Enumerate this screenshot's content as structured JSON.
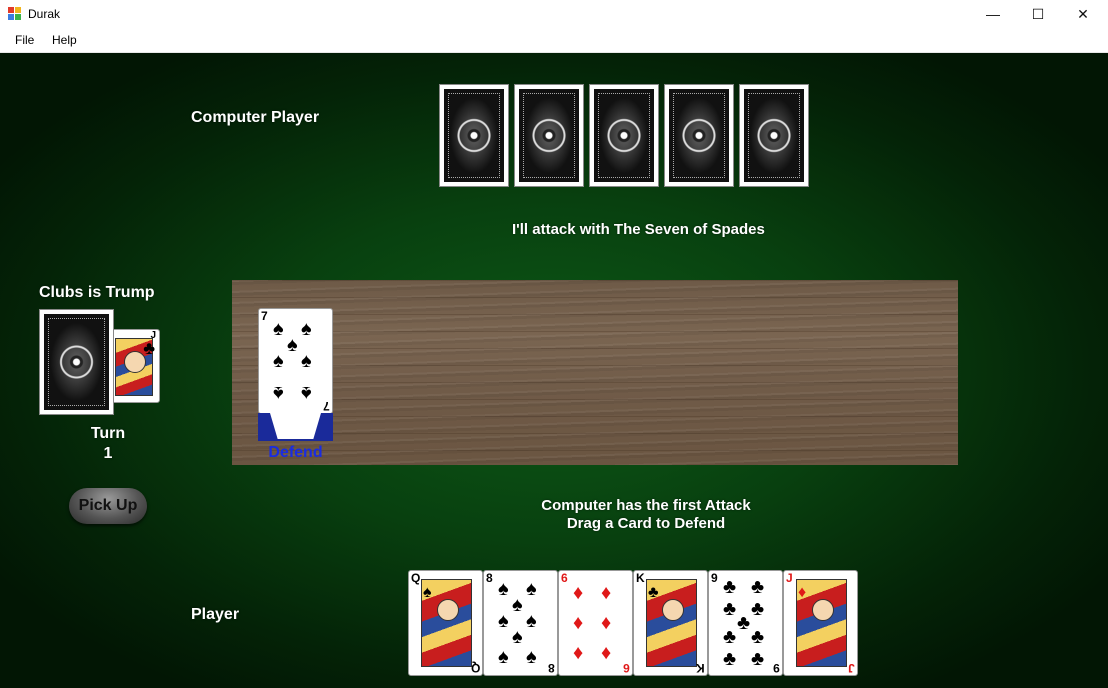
{
  "window": {
    "title": "Durak",
    "minimize": "—",
    "maximize": "☐",
    "close": "✕"
  },
  "menu": {
    "file": "File",
    "help": "Help"
  },
  "labels": {
    "computer_player": "Computer Player",
    "computer_message": "I'll attack with The Seven of Spades",
    "trump": "Clubs is Trump",
    "turn_label": "Turn",
    "turn_number": "1",
    "defend": "Defend",
    "status_line1": "Computer has the first Attack",
    "status_line2": "Drag a Card to Defend",
    "player": "Player",
    "pick_up": "Pick Up"
  },
  "computer_hand_count": 5,
  "trump_card": {
    "rank": "J",
    "suit": "♣",
    "color": "black"
  },
  "attack_card": {
    "rank": "7",
    "suit": "♠",
    "color": "black"
  },
  "player_hand": [
    {
      "rank": "Q",
      "suit": "♠",
      "color": "black",
      "court": true
    },
    {
      "rank": "8",
      "suit": "♠",
      "color": "black",
      "court": false
    },
    {
      "rank": "6",
      "suit": "♦",
      "color": "red",
      "court": false
    },
    {
      "rank": "K",
      "suit": "♣",
      "color": "black",
      "court": true
    },
    {
      "rank": "9",
      "suit": "♣",
      "color": "black",
      "court": false
    },
    {
      "rank": "J",
      "suit": "♦",
      "color": "red",
      "court": true
    }
  ]
}
